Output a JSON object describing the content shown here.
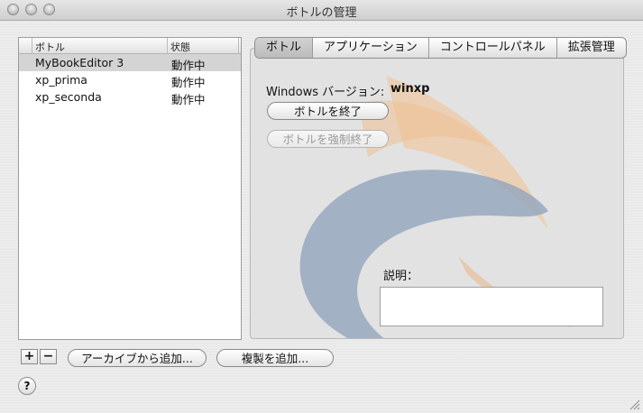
{
  "window": {
    "title": "ボトルの管理"
  },
  "bottle_list": {
    "columns": [
      "ボトル",
      "状態"
    ],
    "rows": [
      {
        "name": "MyBookEditor 3",
        "status": "動作中",
        "selected": true
      },
      {
        "name": "xp_prima",
        "status": "動作中",
        "selected": false
      },
      {
        "name": "xp_seconda",
        "status": "動作中",
        "selected": false
      }
    ]
  },
  "tabs": [
    {
      "label": "ボトル",
      "active": true
    },
    {
      "label": "アプリケーション",
      "active": false
    },
    {
      "label": "コントロールパネル",
      "active": false
    },
    {
      "label": "拡張管理",
      "active": false
    }
  ],
  "bottle_tab": {
    "windows_version_label": "Windows バージョン:",
    "windows_version_value": "winxp",
    "stop_button": "ボトルを終了",
    "force_stop_button": "ボトルを強制終了",
    "description_label": "説明："
  },
  "bottom_bar": {
    "add_symbol": "+",
    "remove_symbol": "−",
    "add_from_archive": "アーカイブから追加...",
    "add_duplicate": "複製を追加...",
    "help_symbol": "?"
  },
  "icons": [
    "close-traffic-light-icon",
    "minimize-traffic-light-icon",
    "zoom-traffic-light-icon",
    "resize-grip-icon",
    "crossover-logo-watermark"
  ],
  "colors": {
    "selected_row": "#d4d4d4",
    "watermark_blue": "#8ea0bb",
    "watermark_orange": "#e9b27c"
  }
}
